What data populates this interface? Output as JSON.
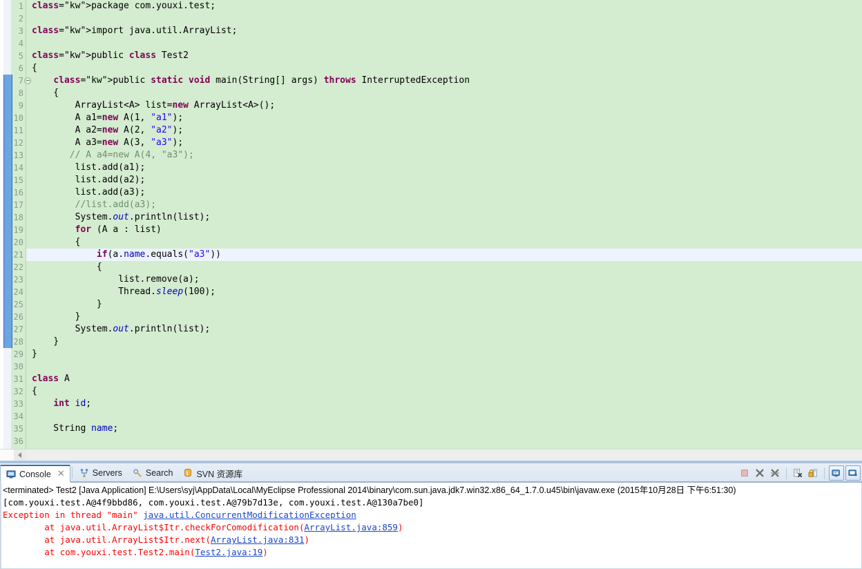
{
  "editor": {
    "language": "java",
    "first_line": 1,
    "current_line": 21,
    "fold_lines": [
      7
    ],
    "lines": [
      {
        "n": 1,
        "text": "package com.youxi.test;"
      },
      {
        "n": 2,
        "text": ""
      },
      {
        "n": 3,
        "text": "import java.util.ArrayList;"
      },
      {
        "n": 4,
        "text": ""
      },
      {
        "n": 5,
        "text": "public class Test2"
      },
      {
        "n": 6,
        "text": "{"
      },
      {
        "n": 7,
        "text": "    public static void main(String[] args) throws InterruptedException"
      },
      {
        "n": 8,
        "text": "    {"
      },
      {
        "n": 9,
        "text": "        ArrayList<A> list=new ArrayList<A>();"
      },
      {
        "n": 10,
        "text": "        A a1=new A(1, \"a1\");"
      },
      {
        "n": 11,
        "text": "        A a2=new A(2, \"a2\");"
      },
      {
        "n": 12,
        "text": "        A a3=new A(3, \"a3\");"
      },
      {
        "n": 13,
        "text": "       // A a4=new A(4, \"a3\");"
      },
      {
        "n": 14,
        "text": "        list.add(a1);"
      },
      {
        "n": 15,
        "text": "        list.add(a2);"
      },
      {
        "n": 16,
        "text": "        list.add(a3);"
      },
      {
        "n": 17,
        "text": "        //list.add(a3);"
      },
      {
        "n": 18,
        "text": "        System.out.println(list);"
      },
      {
        "n": 19,
        "text": "        for (A a : list)"
      },
      {
        "n": 20,
        "text": "        {"
      },
      {
        "n": 21,
        "text": "            if(a.name.equals(\"a3\"))"
      },
      {
        "n": 22,
        "text": "            {"
      },
      {
        "n": 23,
        "text": "                list.remove(a);"
      },
      {
        "n": 24,
        "text": "                Thread.sleep(100);"
      },
      {
        "n": 25,
        "text": "            }"
      },
      {
        "n": 26,
        "text": "        }"
      },
      {
        "n": 27,
        "text": "        System.out.println(list);"
      },
      {
        "n": 28,
        "text": "    }"
      },
      {
        "n": 29,
        "text": "}"
      },
      {
        "n": 30,
        "text": ""
      },
      {
        "n": 31,
        "text": "class A"
      },
      {
        "n": 32,
        "text": "{"
      },
      {
        "n": 33,
        "text": "    int id;"
      },
      {
        "n": 34,
        "text": ""
      },
      {
        "n": 35,
        "text": "    String name;"
      },
      {
        "n": 36,
        "text": ""
      }
    ]
  },
  "panel": {
    "tabs": [
      {
        "label": "Console",
        "icon": "console-monitor-icon",
        "active": true,
        "closable": true
      },
      {
        "label": "Servers",
        "icon": "servers-icon",
        "active": false,
        "closable": false
      },
      {
        "label": "Search",
        "icon": "search-icon",
        "active": false,
        "closable": false
      },
      {
        "label": "SVN 资源库",
        "icon": "svn-repository-icon",
        "active": false,
        "closable": false
      }
    ],
    "toolbar": [
      {
        "name": "terminate-button",
        "icon": "stop-square-icon",
        "pressed": false
      },
      {
        "name": "remove-launch-button",
        "icon": "remove-x-icon",
        "pressed": false
      },
      {
        "name": "remove-all-launches-button",
        "icon": "remove-all-x-icon",
        "pressed": false
      },
      {
        "name": "clear-console-button",
        "icon": "clear-console-icon",
        "pressed": false
      },
      {
        "name": "scroll-lock-button",
        "icon": "lock-icon",
        "pressed": false
      },
      {
        "name": "show-console-button",
        "icon": "display-console-icon",
        "pressed": true
      },
      {
        "name": "pin-console-button",
        "icon": "pin-console-icon",
        "pressed": true
      }
    ]
  },
  "console": {
    "header": "<terminated> Test2 [Java Application] E:\\Users\\syj\\AppData\\Local\\MyEclipse Professional 2014\\binary\\com.sun.java.jdk7.win32.x86_64_1.7.0.u45\\bin\\javaw.exe (2015年10月28日 下午6:51:30)",
    "output": [
      {
        "type": "stdout",
        "segments": [
          {
            "text": "[com.youxi.test.A@4f9bbd86, com.youxi.test.A@79b7d13e, com.youxi.test.A@130a7be0]",
            "style": "plain"
          }
        ]
      },
      {
        "type": "stderr",
        "segments": [
          {
            "text": "Exception in thread \"main\" ",
            "style": "error"
          },
          {
            "text": "java.util.ConcurrentModificationException",
            "style": "link"
          }
        ]
      },
      {
        "type": "stderr",
        "segments": [
          {
            "text": "\tat java.util.ArrayList$Itr.checkForComodification(",
            "style": "error"
          },
          {
            "text": "ArrayList.java:859",
            "style": "link"
          },
          {
            "text": ")",
            "style": "error"
          }
        ]
      },
      {
        "type": "stderr",
        "segments": [
          {
            "text": "\tat java.util.ArrayList$Itr.next(",
            "style": "error"
          },
          {
            "text": "ArrayList.java:831",
            "style": "link"
          },
          {
            "text": ")",
            "style": "error"
          }
        ]
      },
      {
        "type": "stderr",
        "segments": [
          {
            "text": "\tat com.youxi.test.Test2.main(",
            "style": "error"
          },
          {
            "text": "Test2.java:19",
            "style": "link"
          },
          {
            "text": ")",
            "style": "error"
          }
        ]
      }
    ]
  },
  "colors": {
    "editor_background": "#d4ecd0",
    "current_line": "#edf4fd",
    "keyword": "#7f0055",
    "string": "#2a00ff",
    "comment": "#6f8f6f",
    "field": "#0000c0",
    "error_text": "#ff0000",
    "link_text": "#1a46c8",
    "change_bar": "#1f6fd0"
  },
  "scrollbar": {
    "editor_horizontal_visible": true,
    "left_arrow": "◄"
  }
}
